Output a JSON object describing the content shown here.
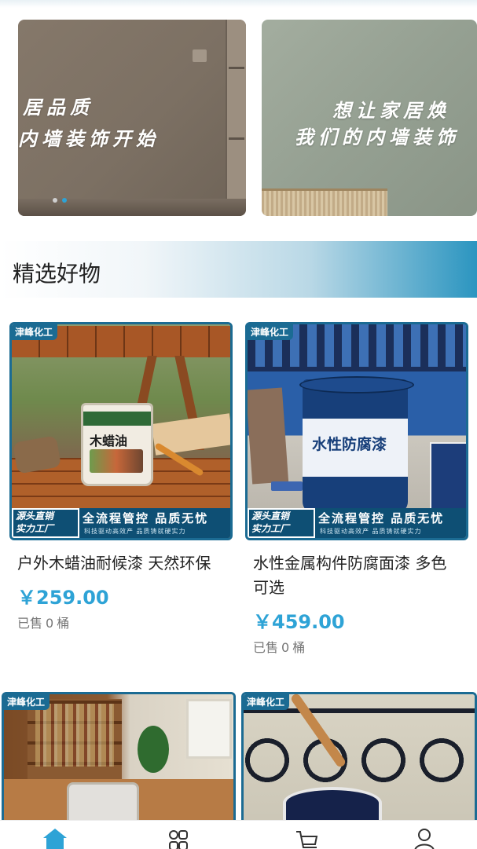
{
  "banner": {
    "slides": [
      {
        "line1": "居品质",
        "line2": "内墙装饰开始"
      },
      {
        "line1": "想让家居焕",
        "line2": "我们的内墙装饰"
      }
    ],
    "active_dot": 1,
    "dot_count": 2
  },
  "section": {
    "title": "精选好物"
  },
  "promo": {
    "left_line1": "源头直销",
    "left_line2": "实力工厂",
    "right_main": "全流程管控 品质无忧",
    "right_sub": "科技驱动高效产 品质铸就硬实力"
  },
  "products": [
    {
      "brand": "津峰化工",
      "can_label": "木蜡油",
      "title": "户外木蜡油耐候漆 天然环保",
      "price": "￥259.00",
      "sold_prefix": "已售",
      "sold_count": "0",
      "sold_unit": "桶"
    },
    {
      "brand": "津峰化工",
      "can_label": "水性防腐漆",
      "title": "水性金属构件防腐面漆 多色可选",
      "price": "￥459.00",
      "sold_prefix": "已售",
      "sold_count": "0",
      "sold_unit": "桶"
    },
    {
      "brand": "津峰化工"
    },
    {
      "brand": "津峰化工"
    }
  ],
  "nav": {
    "items": [
      {
        "icon": "home-icon",
        "active": true
      },
      {
        "icon": "category-icon",
        "active": false
      },
      {
        "icon": "cart-icon",
        "active": false
      },
      {
        "icon": "user-icon",
        "active": false
      }
    ],
    "active_color": "#2ea3d6",
    "inactive_color": "#333333"
  }
}
